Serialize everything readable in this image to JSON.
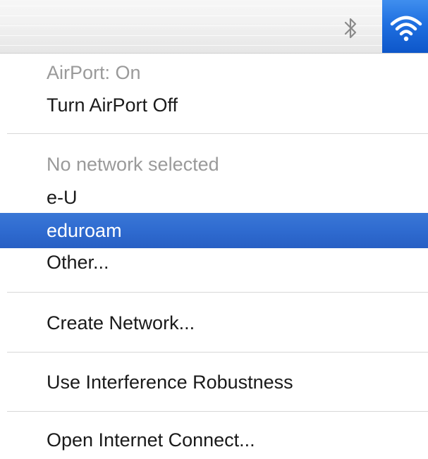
{
  "menubar": {
    "bluetooth_icon": "bluetooth-icon",
    "airport_icon": "wifi-icon",
    "highlight_color": "#1f6fe0"
  },
  "menu": {
    "airport_status": "AirPort: On",
    "toggle_airport": "Turn AirPort Off",
    "no_network": "No network selected",
    "networks": [
      "e-U",
      "eduroam",
      "Other..."
    ],
    "selected_network": "eduroam",
    "create_network": "Create Network...",
    "interference": "Use Interference Robustness",
    "open_internet_connect": "Open Internet Connect...",
    "selection_color": "#2f6bd0",
    "disabled_text_color": "#9a9a9a"
  }
}
